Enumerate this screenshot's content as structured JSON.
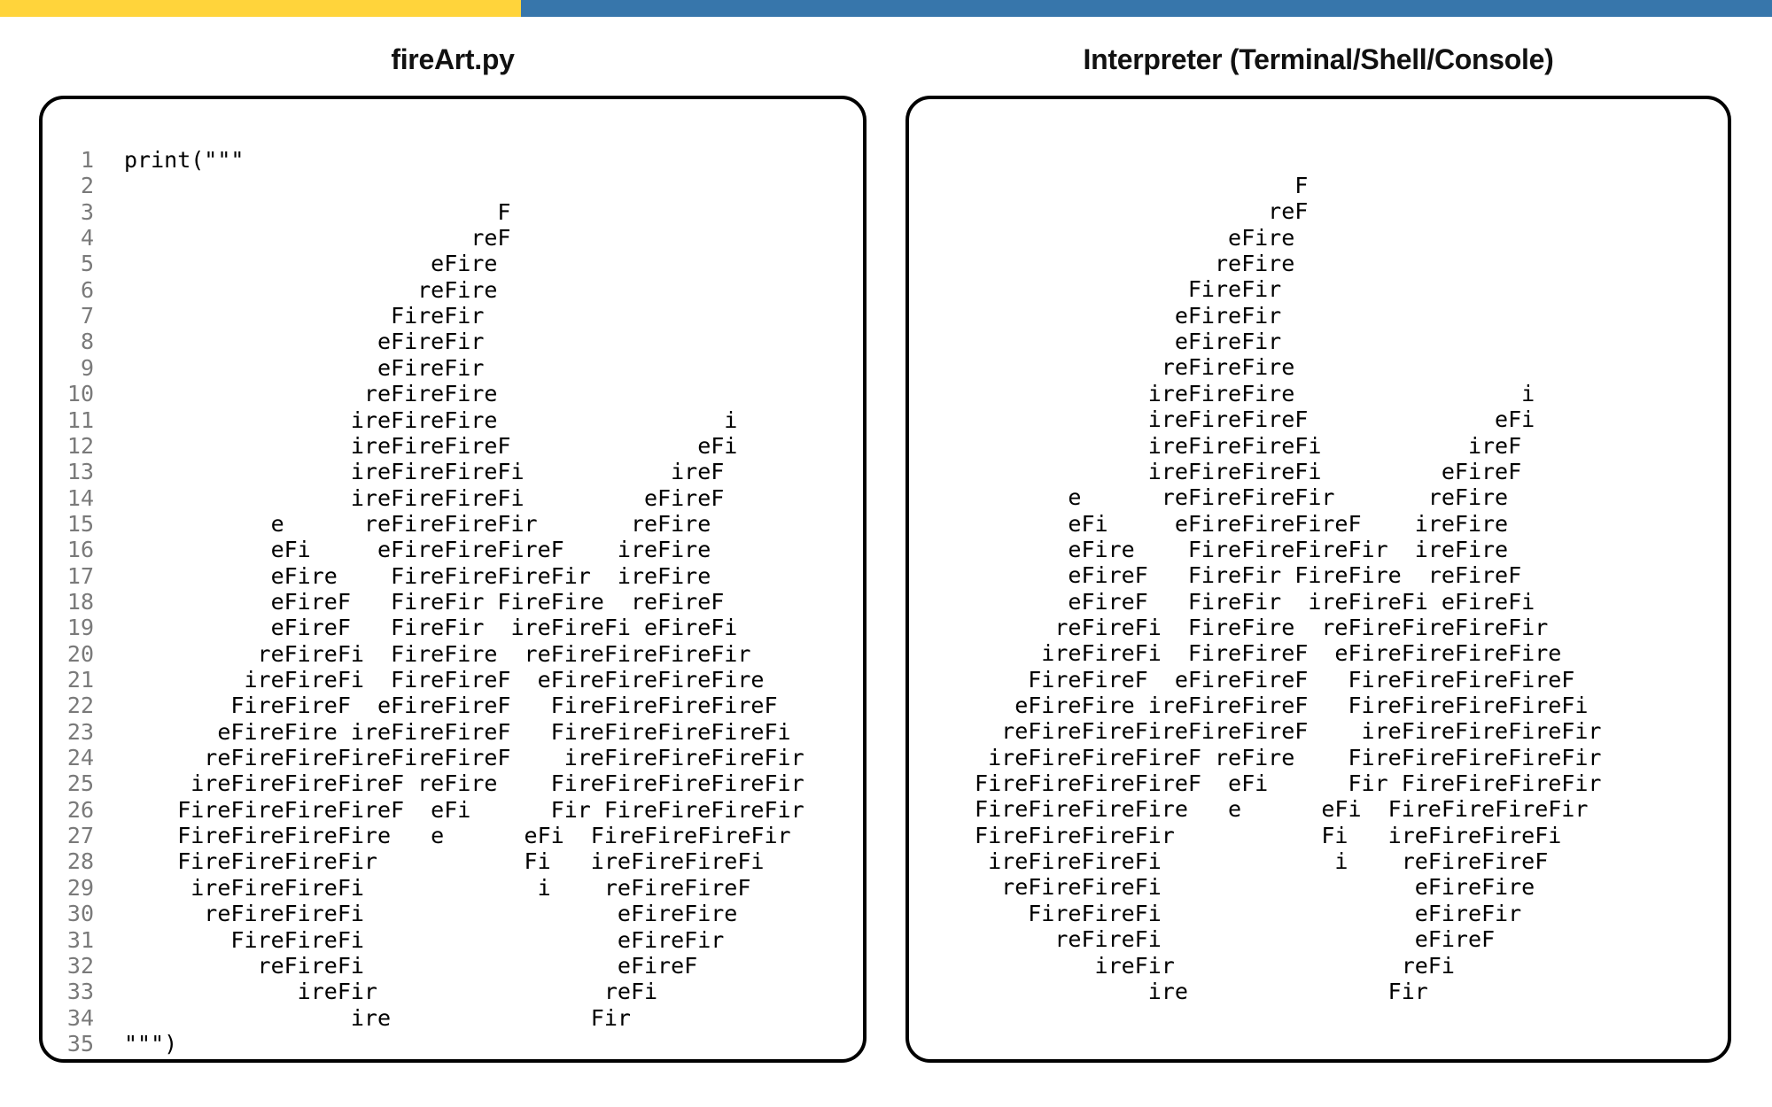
{
  "colors": {
    "accent_yellow": "#ffd43b",
    "accent_blue": "#3776ab",
    "line_number": "#7a7a7a"
  },
  "editor": {
    "title": "fireArt.py",
    "lines": [
      "print(\"\"\"",
      "",
      "                            F",
      "                          reF",
      "                       eFire",
      "                      reFire",
      "                    FireFir",
      "                   eFireFir",
      "                   eFireFir",
      "                  reFireFire",
      "                 ireFireFire                 i",
      "                 ireFireFireF              eFi",
      "                 ireFireFireFi           ireF",
      "                 ireFireFireFi         eFireF",
      "           e      reFireFireFir       reFire",
      "           eFi     eFireFireFireF    ireFire",
      "           eFire    FireFireFireFir  ireFire",
      "           eFireF   FireFir FireFire  reFireF",
      "           eFireF   FireFir  ireFireFi eFireFi",
      "          reFireFi  FireFire  reFireFireFireFir",
      "         ireFireFi  FireFireF  eFireFireFireFire",
      "        FireFireF  eFireFireF   FireFireFireFireF",
      "       eFireFire ireFireFireF   FireFireFireFireFi",
      "      reFireFireFireFireFireF    ireFireFireFireFir",
      "     ireFireFireFireF reFire    FireFireFireFireFir",
      "    FireFireFireFireF  eFi      Fir FireFireFireFir",
      "    FireFireFireFire   e      eFi  FireFireFireFir",
      "    FireFireFireFir           Fi   ireFireFireFi",
      "     ireFireFireFi             i    reFireFireF",
      "      reFireFireFi                   eFireFire",
      "        FireFireFi                   eFireFir",
      "          reFireFi                   eFireF",
      "             ireFir                 reFi",
      "                 ire               Fir",
      "\"\"\")"
    ]
  },
  "console": {
    "title": "Interpreter (Terminal/Shell/Console)",
    "lines": [
      "                         F",
      "                       reF",
      "                    eFire",
      "                   reFire",
      "                 FireFir",
      "                eFireFir",
      "                eFireFir",
      "               reFireFire",
      "              ireFireFire                 i",
      "              ireFireFireF              eFi",
      "              ireFireFireFi           ireF",
      "              ireFireFireFi         eFireF",
      "        e      reFireFireFir       reFire",
      "        eFi     eFireFireFireF    ireFire",
      "        eFire    FireFireFireFir  ireFire",
      "        eFireF   FireFir FireFire  reFireF",
      "        eFireF   FireFir  ireFireFi eFireFi",
      "       reFireFi  FireFire  reFireFireFireFir",
      "      ireFireFi  FireFireF  eFireFireFireFire",
      "     FireFireF  eFireFireF   FireFireFireFireF",
      "    eFireFire ireFireFireF   FireFireFireFireFi",
      "   reFireFireFireFireFireF    ireFireFireFireFir",
      "  ireFireFireFireF reFire    FireFireFireFireFir",
      " FireFireFireFireF  eFi      Fir FireFireFireFir",
      " FireFireFireFire   e      eFi  FireFireFireFir",
      " FireFireFireFir           Fi   ireFireFireFi",
      "  ireFireFireFi             i    reFireFireF",
      "   reFireFireFi                   eFireFire",
      "     FireFireFi                   eFireFir",
      "       reFireFi                   eFireF",
      "          ireFir                 reFi",
      "              ire               Fir"
    ]
  }
}
